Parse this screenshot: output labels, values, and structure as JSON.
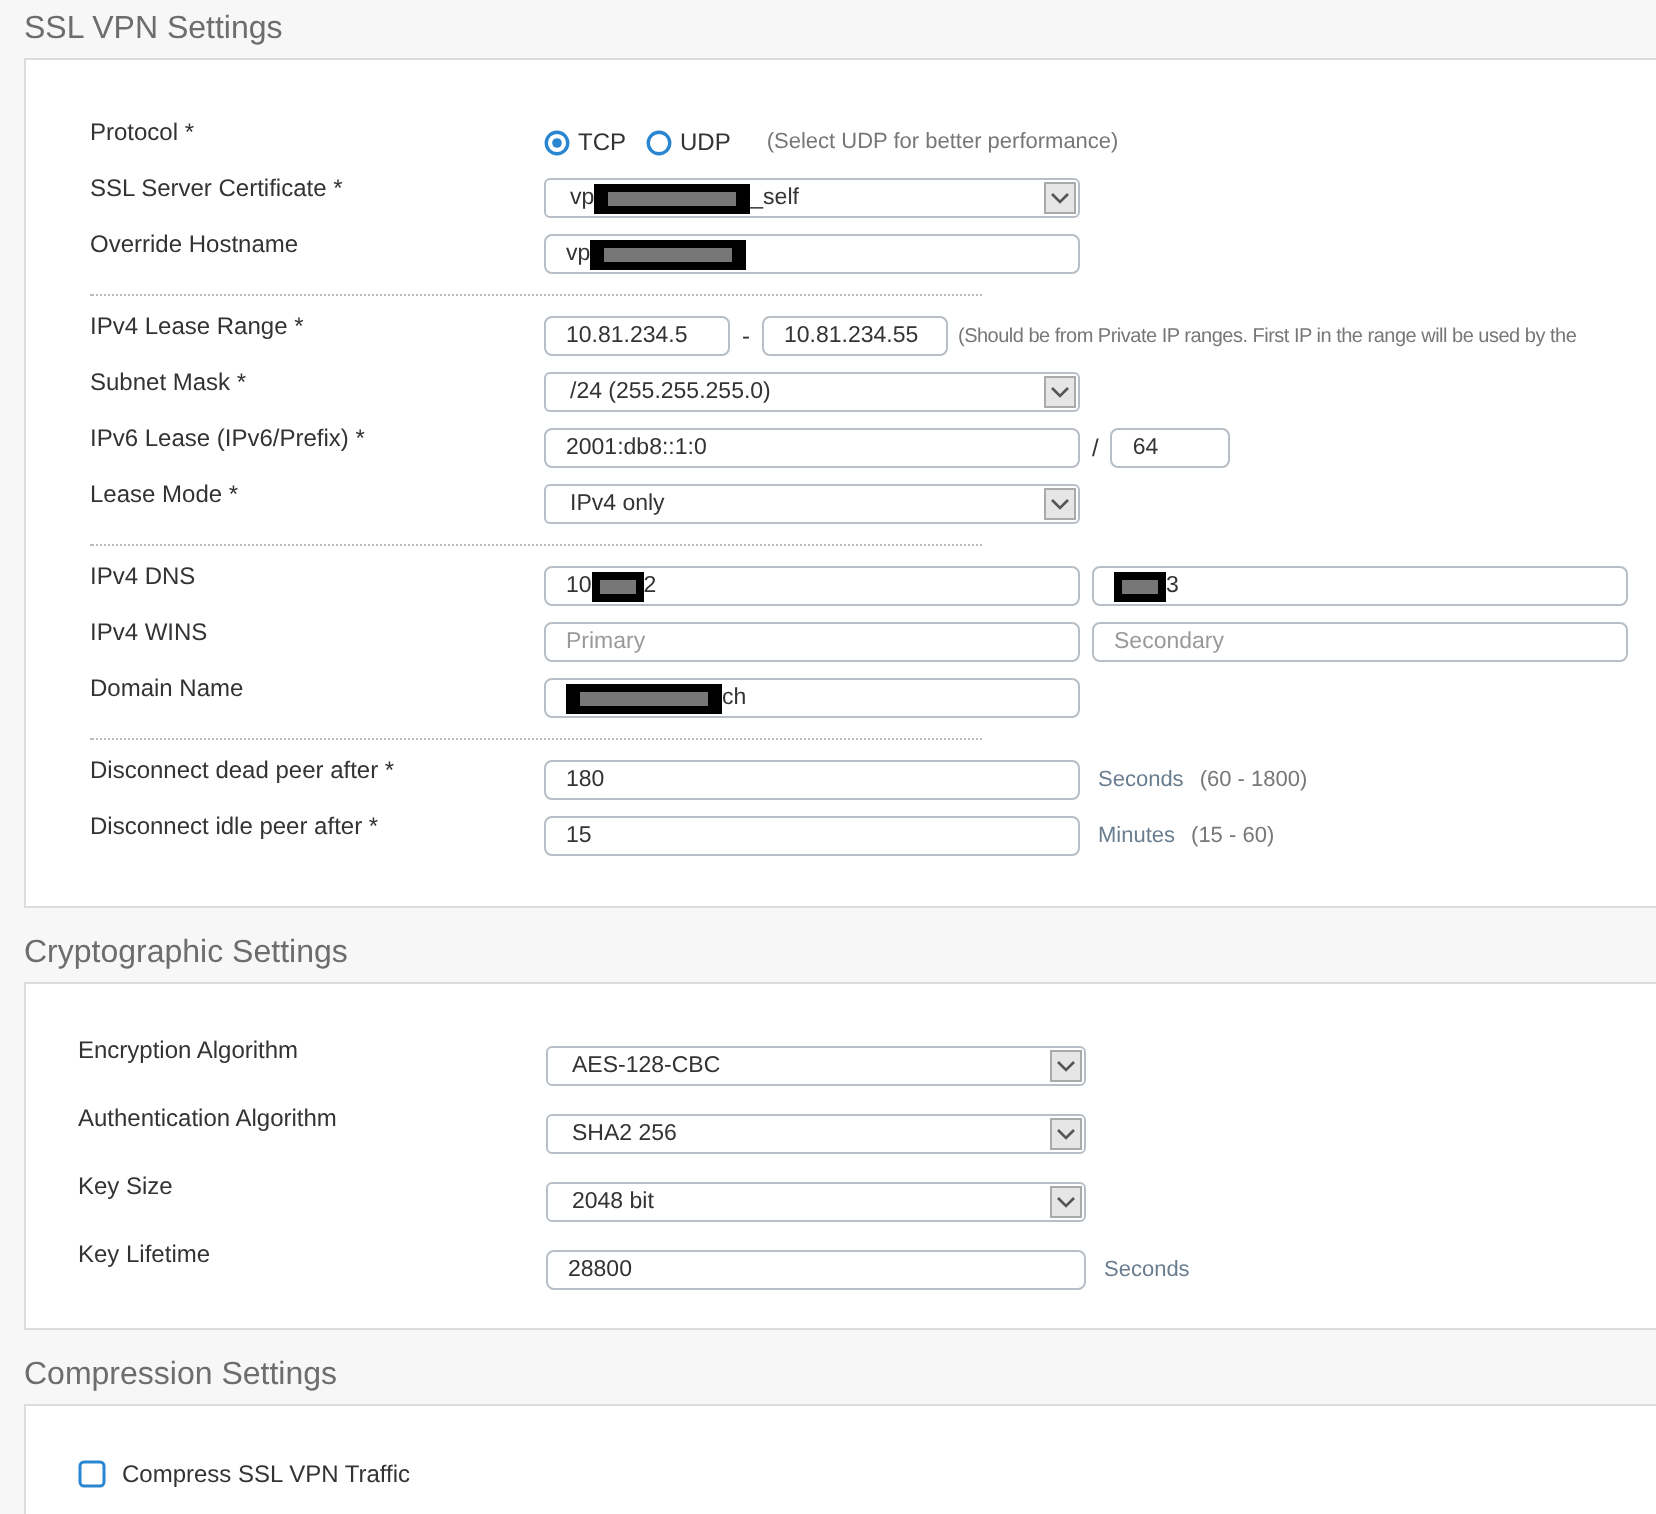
{
  "sections": [
    {
      "title": "SSL VPN Settings",
      "groups": [
        [
          {
            "kind": "radio",
            "label": "Protocol *",
            "options": [
              {
                "label": "TCP",
                "selected": true
              },
              {
                "label": "UDP",
                "selected": false
              }
            ],
            "hint": "(Select UDP for better performance)"
          },
          {
            "kind": "select",
            "label": "SSL Server Certificate *",
            "value": [
              {
                "kind": "text",
                "text": "vp"
              },
              {
                "kind": "redacted"
              },
              {
                "kind": "text",
                "text": "_self"
              }
            ]
          },
          {
            "kind": "text",
            "label": "Override Hostname",
            "value": [
              {
                "kind": "text",
                "text": "vp"
              },
              {
                "kind": "redacted"
              }
            ]
          }
        ],
        [
          {
            "kind": "range",
            "label": "IPv4 Lease Range *",
            "from": "10.81.234.5",
            "separator": "-",
            "to": "10.81.234.55",
            "hint": "(Should be from Private IP ranges. First IP in the range will be used by the"
          },
          {
            "kind": "select",
            "label": "Subnet Mask *",
            "value": [
              {
                "kind": "text",
                "text": "/24 (255.255.255.0)"
              }
            ]
          },
          {
            "kind": "prefix",
            "label": "IPv6 Lease (IPv6/Prefix) *",
            "address": "2001:db8::1:0",
            "separator": "/",
            "prefix": "64"
          },
          {
            "kind": "select",
            "label": "Lease Mode *",
            "value": [
              {
                "kind": "text",
                "text": "IPv4 only"
              }
            ]
          }
        ],
        [
          {
            "kind": "pair",
            "label": "IPv4 DNS",
            "fields": [
              {
                "value": [
                  {
                    "kind": "text",
                    "text": "10"
                  },
                  {
                    "kind": "redacted"
                  },
                  {
                    "kind": "text",
                    "text": "2"
                  }
                ]
              },
              {
                "value": [
                  {
                    "kind": "redacted"
                  },
                  {
                    "kind": "text",
                    "text": "3"
                  }
                ]
              }
            ]
          },
          {
            "kind": "pair",
            "label": "IPv4 WINS",
            "fields": [
              {
                "placeholder": "Primary"
              },
              {
                "placeholder": "Secondary"
              }
            ]
          },
          {
            "kind": "text",
            "label": "Domain Name",
            "value": [
              {
                "kind": "redacted"
              },
              {
                "kind": "text",
                "text": "ch"
              }
            ]
          }
        ],
        [
          {
            "kind": "text",
            "label": "Disconnect dead peer after *",
            "value": [
              {
                "kind": "text",
                "text": "180"
              }
            ],
            "unit": "Seconds",
            "hint": "(60 - 1800)"
          },
          {
            "kind": "text",
            "label": "Disconnect idle peer after *",
            "value": [
              {
                "kind": "text",
                "text": "15"
              }
            ],
            "unit": "Minutes",
            "hint": "(15 - 60)"
          }
        ]
      ]
    },
    {
      "title": "Cryptographic Settings",
      "groups": [
        [
          {
            "kind": "select",
            "label": "Encryption Algorithm",
            "value": [
              {
                "kind": "text",
                "text": "AES-128-CBC"
              }
            ]
          },
          {
            "kind": "select",
            "label": "Authentication Algorithm",
            "value": [
              {
                "kind": "text",
                "text": "SHA2 256"
              }
            ]
          },
          {
            "kind": "select",
            "label": "Key Size",
            "value": [
              {
                "kind": "text",
                "text": "2048 bit"
              }
            ]
          },
          {
            "kind": "text",
            "label": "Key Lifetime",
            "value": [
              {
                "kind": "text",
                "text": "28800"
              }
            ],
            "unit": "Seconds"
          }
        ]
      ]
    },
    {
      "title": "Compression Settings",
      "groups": [
        [
          {
            "kind": "checkbox",
            "label": "Compress SSL VPN Traffic",
            "checked": false
          }
        ]
      ]
    }
  ]
}
